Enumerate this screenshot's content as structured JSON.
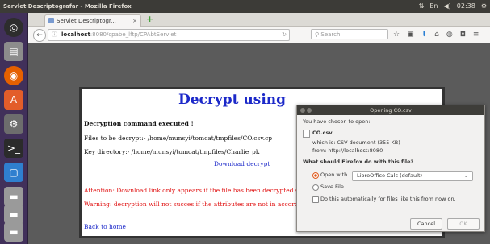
{
  "window": {
    "title": "Servlet Descriptografar - Mozilla Firefox",
    "clock": "02:38"
  },
  "tabs": [
    {
      "label": "Servlet Descriptogr...",
      "close": "×"
    }
  ],
  "newtab_label": "+",
  "url": {
    "host": "localhost",
    "rest": ":8080/cpabe_lftp/CPAbtServlet"
  },
  "search": {
    "placeholder": "Search"
  },
  "page": {
    "title": "Decrypt using",
    "cmd_line": "Decryption command executed !",
    "files_line": "Files to be decrypt:- /home/munsyi/tomcat/tmpfiles/CO.csv.cp",
    "key_line": "Key directory:- /home/munsyi/tomcat/tmpfiles/Charlie_pk",
    "download_link": "Download decrypt",
    "attention": "Attention: Download link only appears if the file has been decrypted successfully.",
    "warning": "Warning: decryption will not succes if the attributes are not in accordance with police rules of ciphertest!",
    "back_link": "Back to home"
  },
  "dialog": {
    "title": "Opening CO.csv",
    "chosen": "You have chosen to open:",
    "filename": "CO.csv",
    "which_is": "which is: CSV document (355 KB)",
    "from": "from: http://localhost:8080",
    "question": "What should Firefox do with this file?",
    "open_with": "Open with",
    "app": "LibreOffice Calc (default)",
    "save_file": "Save File",
    "auto": "Do this automatically for files like this from now on.",
    "cancel": "Cancel",
    "ok": "OK"
  },
  "colors": {
    "launcher": "#41305a",
    "page_bg": "#5b5b5b",
    "link": "#1c29c9",
    "warn": "#e01010"
  }
}
